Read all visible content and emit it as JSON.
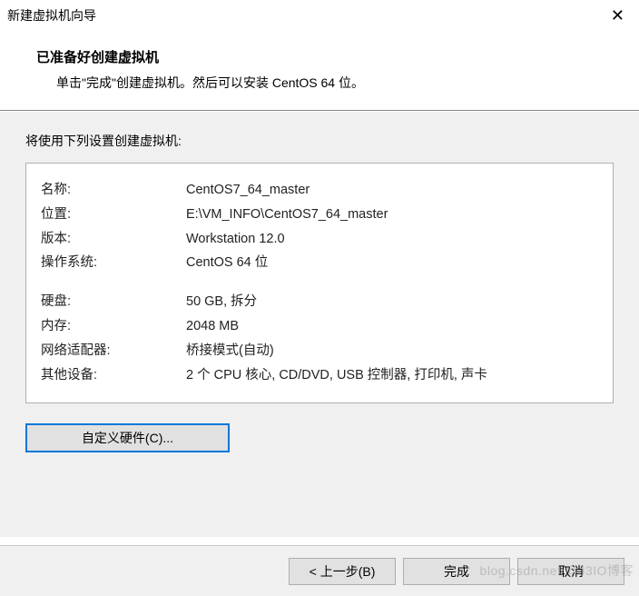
{
  "window": {
    "title": "新建虚拟机向导",
    "close_glyph": "✕"
  },
  "header": {
    "title": "已准备好创建虚拟机",
    "subtitle": "单击\"完成\"创建虚拟机。然后可以安装 CentOS 64 位。"
  },
  "body": {
    "lead": "将使用下列设置创建虚拟机:",
    "summary_group1": [
      {
        "label": "名称:",
        "value": "CentOS7_64_master"
      },
      {
        "label": "位置:",
        "value": "E:\\VM_INFO\\CentOS7_64_master"
      },
      {
        "label": "版本:",
        "value": "Workstation 12.0"
      },
      {
        "label": "操作系统:",
        "value": "CentOS 64 位"
      }
    ],
    "summary_group2": [
      {
        "label": "硬盘:",
        "value": "50 GB, 拆分"
      },
      {
        "label": "内存:",
        "value": "2048 MB"
      },
      {
        "label": "网络适配器:",
        "value": "桥接模式(自动)"
      },
      {
        "label": "其他设备:",
        "value": "2 个 CPU 核心, CD/DVD, USB 控制器, 打印机, 声卡"
      }
    ],
    "customize_button": "自定义硬件(C)..."
  },
  "footer": {
    "back": "< 上一步(B)",
    "finish": "完成",
    "cancel": "取消"
  },
  "watermark": "blog.csdn.net/@J3IO博客"
}
